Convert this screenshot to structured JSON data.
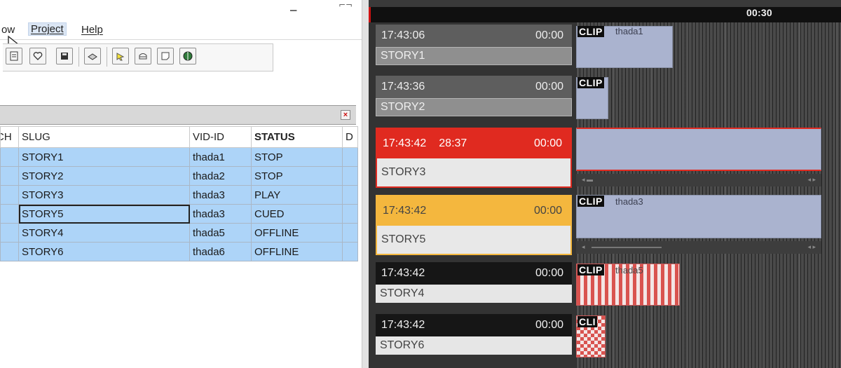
{
  "menubar": {
    "items": [
      {
        "label": "ow",
        "underline": false
      },
      {
        "label": "Project",
        "underline": true
      },
      {
        "label": "Help",
        "underline": true
      }
    ]
  },
  "toolbar": {
    "buttons": [
      "open-icon",
      "heart-icon",
      "save-icon",
      "print-icon",
      "pointer-icon",
      "stack-icon",
      "note-icon",
      "globe-icon"
    ]
  },
  "grid": {
    "columns": [
      "CH",
      "SLUG",
      "VID-ID",
      "STATUS",
      "D"
    ],
    "rows": [
      {
        "slug": "STORY1",
        "vid_id": "thada1",
        "status": "STOP"
      },
      {
        "slug": "STORY2",
        "vid_id": "thada2",
        "status": "STOP"
      },
      {
        "slug": "STORY3",
        "vid_id": "thada3",
        "status": "PLAY"
      },
      {
        "slug": "STORY5",
        "vid_id": "thada3",
        "status": "CUED"
      },
      {
        "slug": "STORY4",
        "vid_id": "thada5",
        "status": "OFFLINE"
      },
      {
        "slug": "STORY6",
        "vid_id": "thada6",
        "status": "OFFLINE"
      }
    ]
  },
  "timeline": {
    "time_marker": "00:30",
    "clip_tag": "CLIP",
    "stories": [
      {
        "time": "17:43:06",
        "elapsed": "",
        "duration": "00:00",
        "slug": "STORY1",
        "state": "stop",
        "clip_tag": "CLIP",
        "clip_name": "thada1"
      },
      {
        "time": "17:43:36",
        "elapsed": "",
        "duration": "00:00",
        "slug": "STORY2",
        "state": "stop",
        "clip_tag": "CLIP",
        "clip_name": ""
      },
      {
        "time": "17:43:42",
        "elapsed": "28:37",
        "duration": "00:00",
        "slug": "STORY3",
        "state": "play",
        "clip_tag": "",
        "clip_name": ""
      },
      {
        "time": "17:43:42",
        "elapsed": "",
        "duration": "00:00",
        "slug": "STORY5",
        "state": "cued",
        "clip_tag": "CLIP",
        "clip_name": "thada3"
      },
      {
        "time": "17:43:42",
        "elapsed": "",
        "duration": "00:00",
        "slug": "STORY4",
        "state": "offline",
        "clip_tag": "CLIP",
        "clip_name": "thada5"
      },
      {
        "time": "17:43:42",
        "elapsed": "",
        "duration": "00:00",
        "slug": "STORY6",
        "state": "offline",
        "clip_tag": "CLI",
        "clip_name": ""
      }
    ]
  },
  "colors": {
    "play": "#e02a20",
    "cued": "#f4b73e",
    "stop": "#6d6d6d",
    "offline": "#1a1a1a",
    "grid_selection": "#add4f8",
    "clip_fill": "#aab3cf"
  }
}
